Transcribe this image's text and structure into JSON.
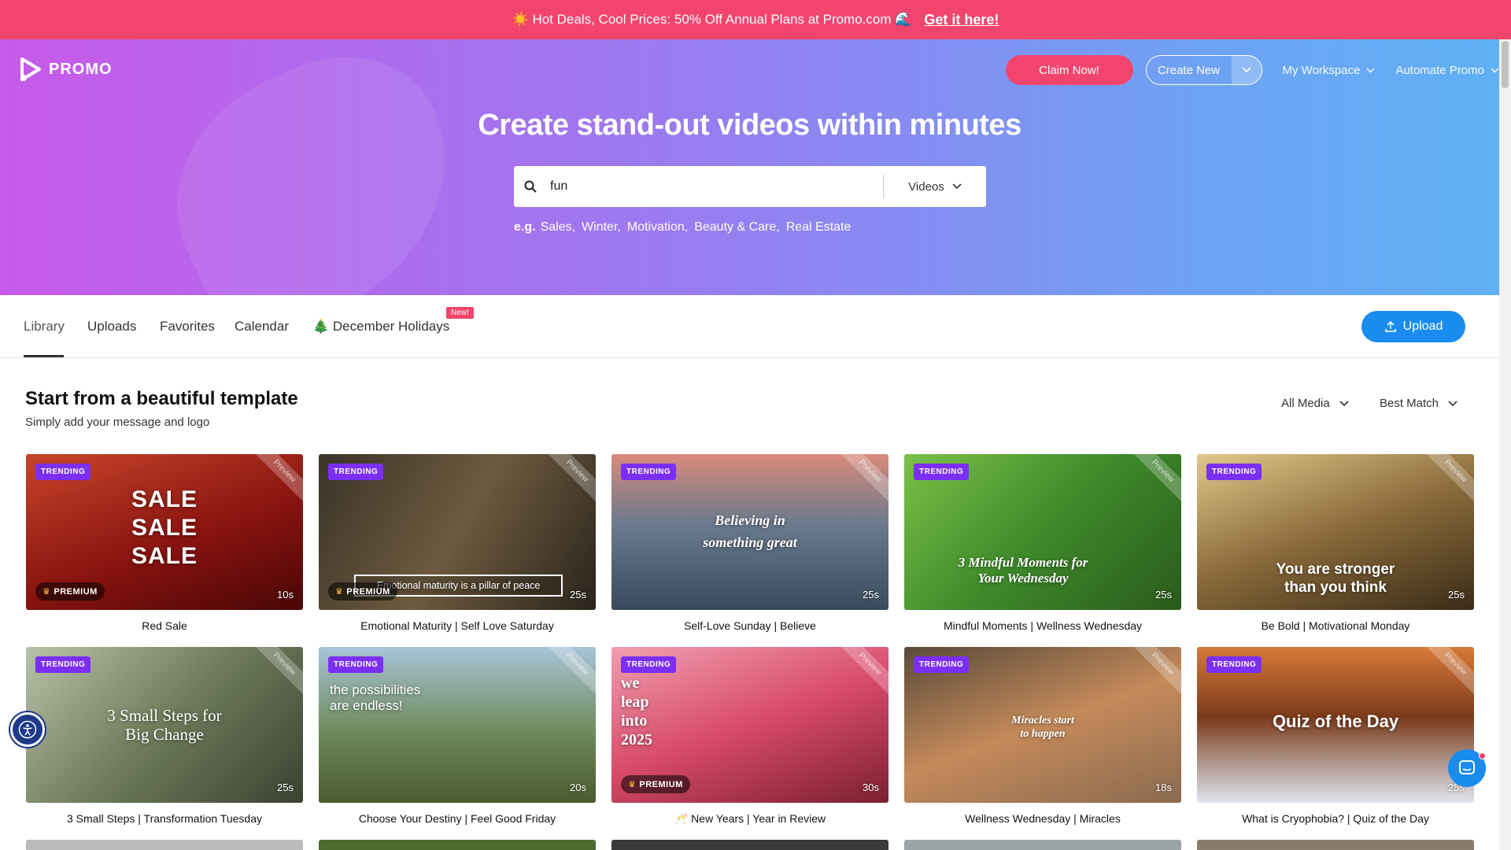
{
  "promo": {
    "text": "☀️ Hot Deals, Cool Prices: 50% Off Annual Plans at Promo.com 🌊",
    "cta": "Get it here!"
  },
  "header": {
    "logo": "PROMO",
    "claim": "Claim Now!",
    "create": "Create New",
    "workspace": "My Workspace",
    "automate": "Automate Promo"
  },
  "hero": {
    "title": "Create stand-out videos within minutes",
    "search_value": "fun",
    "search_type": "Videos",
    "eg_label": "e.g.",
    "examples": [
      "Sales,",
      "Winter,",
      "Motivation,",
      "Beauty & Care,",
      "Real Estate"
    ]
  },
  "tabs": {
    "library": "Library",
    "uploads": "Uploads",
    "favorites": "Favorites",
    "calendar": "Calendar",
    "holidays": "🎄 December Holidays",
    "new_badge": "New!",
    "upload": "Upload"
  },
  "section": {
    "title": "Start from a beautiful template",
    "subtitle": "Simply add your message and logo",
    "filter_media": "All Media",
    "filter_sort": "Best Match"
  },
  "labels": {
    "trending": "TRENDING",
    "premium": "PREMIUM",
    "preview": "Preview"
  },
  "cards": [
    {
      "title": "Red Sale",
      "duration": "10s",
      "premium": true,
      "overlay": "SALE\nSALE\nSALE",
      "bg": "linear-gradient(160deg,#c7452a 0%,#8a1410 55%,#4a0606 100%)"
    },
    {
      "title": "Emotional Maturity | Self Love Saturday",
      "duration": "25s",
      "premium": true,
      "overlay": "Emotional maturity is a pillar of peace",
      "bg": "linear-gradient(120deg,#3a3328 0%,#6d5a3e 50%,#2a241c 100%)"
    },
    {
      "title": "Self-Love Sunday | Believe",
      "duration": "25s",
      "premium": false,
      "overlay": "Believing in\nsomething great",
      "bg": "linear-gradient(180deg,#d98a7a 0%,#6b7a8e 45%,#394a5c 100%)"
    },
    {
      "title": "Mindful Moments | Wellness Wednesday",
      "duration": "25s",
      "premium": false,
      "overlay": "3 Mindful Moments for\nYour Wednesday",
      "bg": "linear-gradient(135deg,#7bc048 0%,#3e8a2a 50%,#2a5a1c 100%)"
    },
    {
      "title": "Be Bold | Motivational Monday",
      "duration": "25s",
      "premium": false,
      "overlay": "You are stronger\nthan you think",
      "bg": "linear-gradient(160deg,#e3c88a 0%,#8a6a3a 50%,#3a2c18 100%)"
    },
    {
      "title": "3 Small Steps | Transformation Tuesday",
      "duration": "25s",
      "premium": false,
      "overlay": "3 Small Steps for\nBig Change",
      "bg": "linear-gradient(135deg,#b9c2a8 0%,#6d7a5a 50%,#3a4230 100%)"
    },
    {
      "title": "Choose Your Destiny | Feel Good Friday",
      "duration": "20s",
      "premium": false,
      "overlay": "the possibilities\nare endless!",
      "bg": "linear-gradient(180deg,#a8c4d8 0%,#6e8a5a 55%,#4a5a2e 100%)"
    },
    {
      "title": "🥂 New Years | Year in Review",
      "duration": "30s",
      "premium": true,
      "overlay": "we\nleap\ninto\n2025",
      "bg": "linear-gradient(160deg,#f0a0b0 0%,#d84a6a 50%,#7a2030 100%)"
    },
    {
      "title": "Wellness Wednesday | Miracles",
      "duration": "18s",
      "premium": false,
      "overlay": "Miracles start\nto happen",
      "bg": "linear-gradient(160deg,#5a4a3a 0%,#c48a5a 50%,#8a6a50 100%)"
    },
    {
      "title": "What is Cryophobia? | Quiz of the Day",
      "duration": "25s",
      "premium": false,
      "overlay": "Quiz of the Day",
      "bg": "linear-gradient(180deg,#d87a3a 0%,#7a3a1a 45%,#dfe6f0 100%)"
    }
  ]
}
